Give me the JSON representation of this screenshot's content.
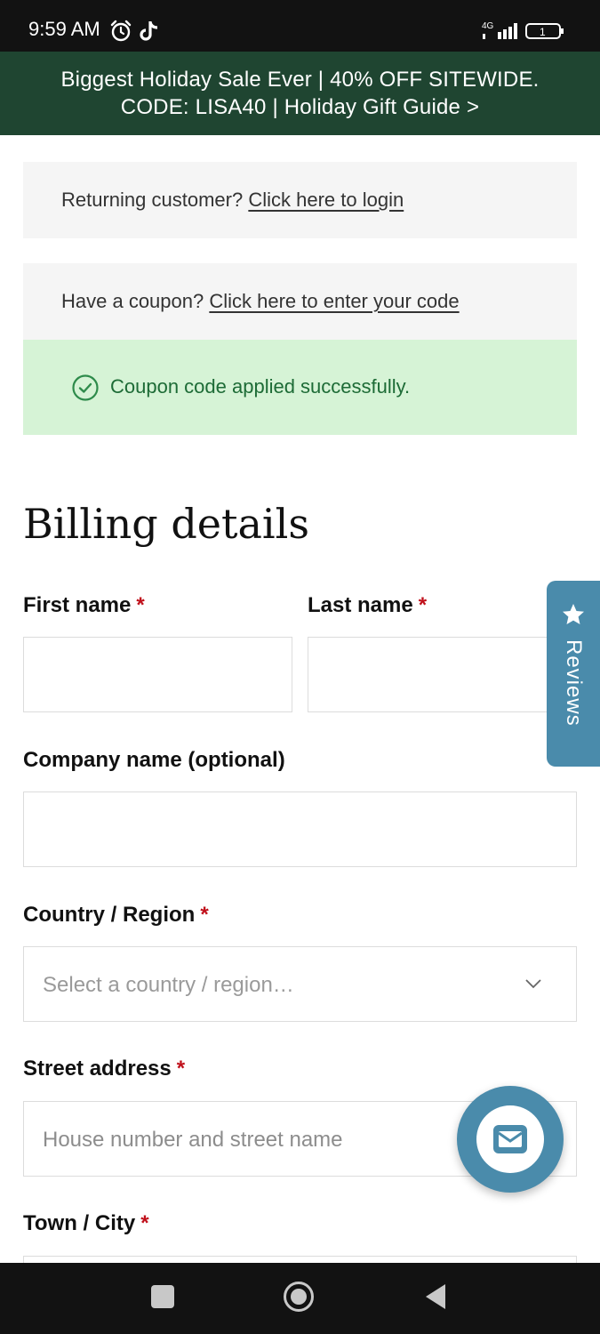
{
  "status_bar": {
    "time": "9:59 AM",
    "network": "4G",
    "battery": "1",
    "icons": [
      "alarm-icon",
      "tiktok-icon",
      "signal-icon",
      "battery-icon"
    ]
  },
  "promo": {
    "line1": "Biggest Holiday Sale Ever | 40% OFF SITEWIDE.",
    "line2": "CODE: LISA40 | Holiday Gift Guide >"
  },
  "notices": {
    "login_prefix": "Returning customer?",
    "login_link": "Click here to login",
    "coupon_prefix": "Have a coupon?",
    "coupon_link": "Click here to enter your code",
    "success_message": "Coupon code applied successfully."
  },
  "billing": {
    "heading": "Billing details",
    "required_marker": "*",
    "first_name_label": "First name",
    "last_name_label": "Last name",
    "company_label": "Company name (optional)",
    "country_label": "Country / Region",
    "country_placeholder": "Select a country / region…",
    "street_label": "Street address",
    "street_placeholder": "House number and street name",
    "town_label": "Town / City"
  },
  "reviews_tab": {
    "label": "Reviews"
  },
  "colors": {
    "promo_bg": "#1f4531",
    "success_bg": "#d6f3d6",
    "success_text": "#1d6b36",
    "accent_blue": "#4a8bab",
    "required_red": "#c0101b"
  }
}
